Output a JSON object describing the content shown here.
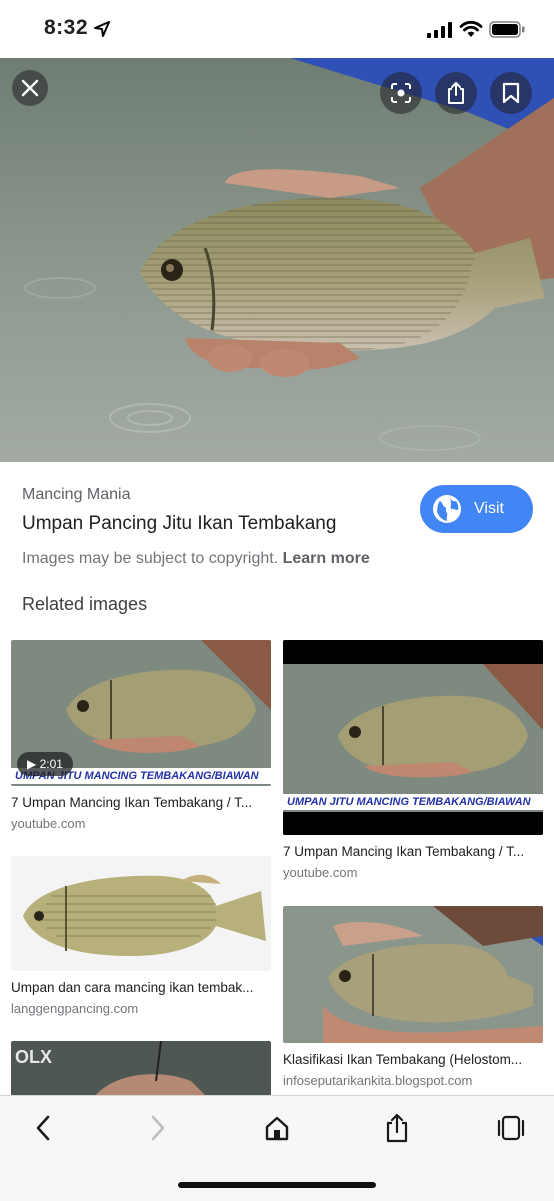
{
  "status_bar": {
    "time": "8:32",
    "icons": [
      "location-arrow-icon",
      "cellular-signal-icon",
      "wifi-icon",
      "battery-icon"
    ]
  },
  "viewer": {
    "buttons": [
      "close-icon",
      "lens-icon",
      "share-icon",
      "bookmark-icon"
    ]
  },
  "result": {
    "source": "Mancing Mania",
    "title": "Umpan Pancing Jitu Ikan Tembakang",
    "visit_label": "Visit",
    "copyright_text": "Images may be subject to copyright.",
    "learn_more": "Learn more"
  },
  "related": {
    "heading": "Related images",
    "items": [
      {
        "caption": "7 Umpan Mancing Ikan Tembakang / T...",
        "domain": "youtube.com",
        "banner": "UMPAN JITU MANCING TEMBAKANG/BIAWAN",
        "duration": "▶ 2:01"
      },
      {
        "caption": "7 Umpan Mancing Ikan Tembakang / T...",
        "domain": "youtube.com",
        "banner": "UMPAN JITU MANCING TEMBAKANG/BIAWAN"
      },
      {
        "caption": "Umpan dan cara mancing ikan tembak...",
        "domain": "langgengpancing.com"
      },
      {
        "caption": "Klasifikasi Ikan Tembakang (Helostom...",
        "domain": "infoseputarikankita.blogspot.com"
      },
      {
        "watermark": "OLX"
      }
    ]
  },
  "toolbar": {
    "buttons": [
      "back-icon",
      "forward-icon",
      "home-icon",
      "share-icon",
      "tabs-icon"
    ]
  },
  "colors": {
    "accent": "#4285f4",
    "water": "#7d8a80",
    "banner_text": "#2332a8"
  }
}
